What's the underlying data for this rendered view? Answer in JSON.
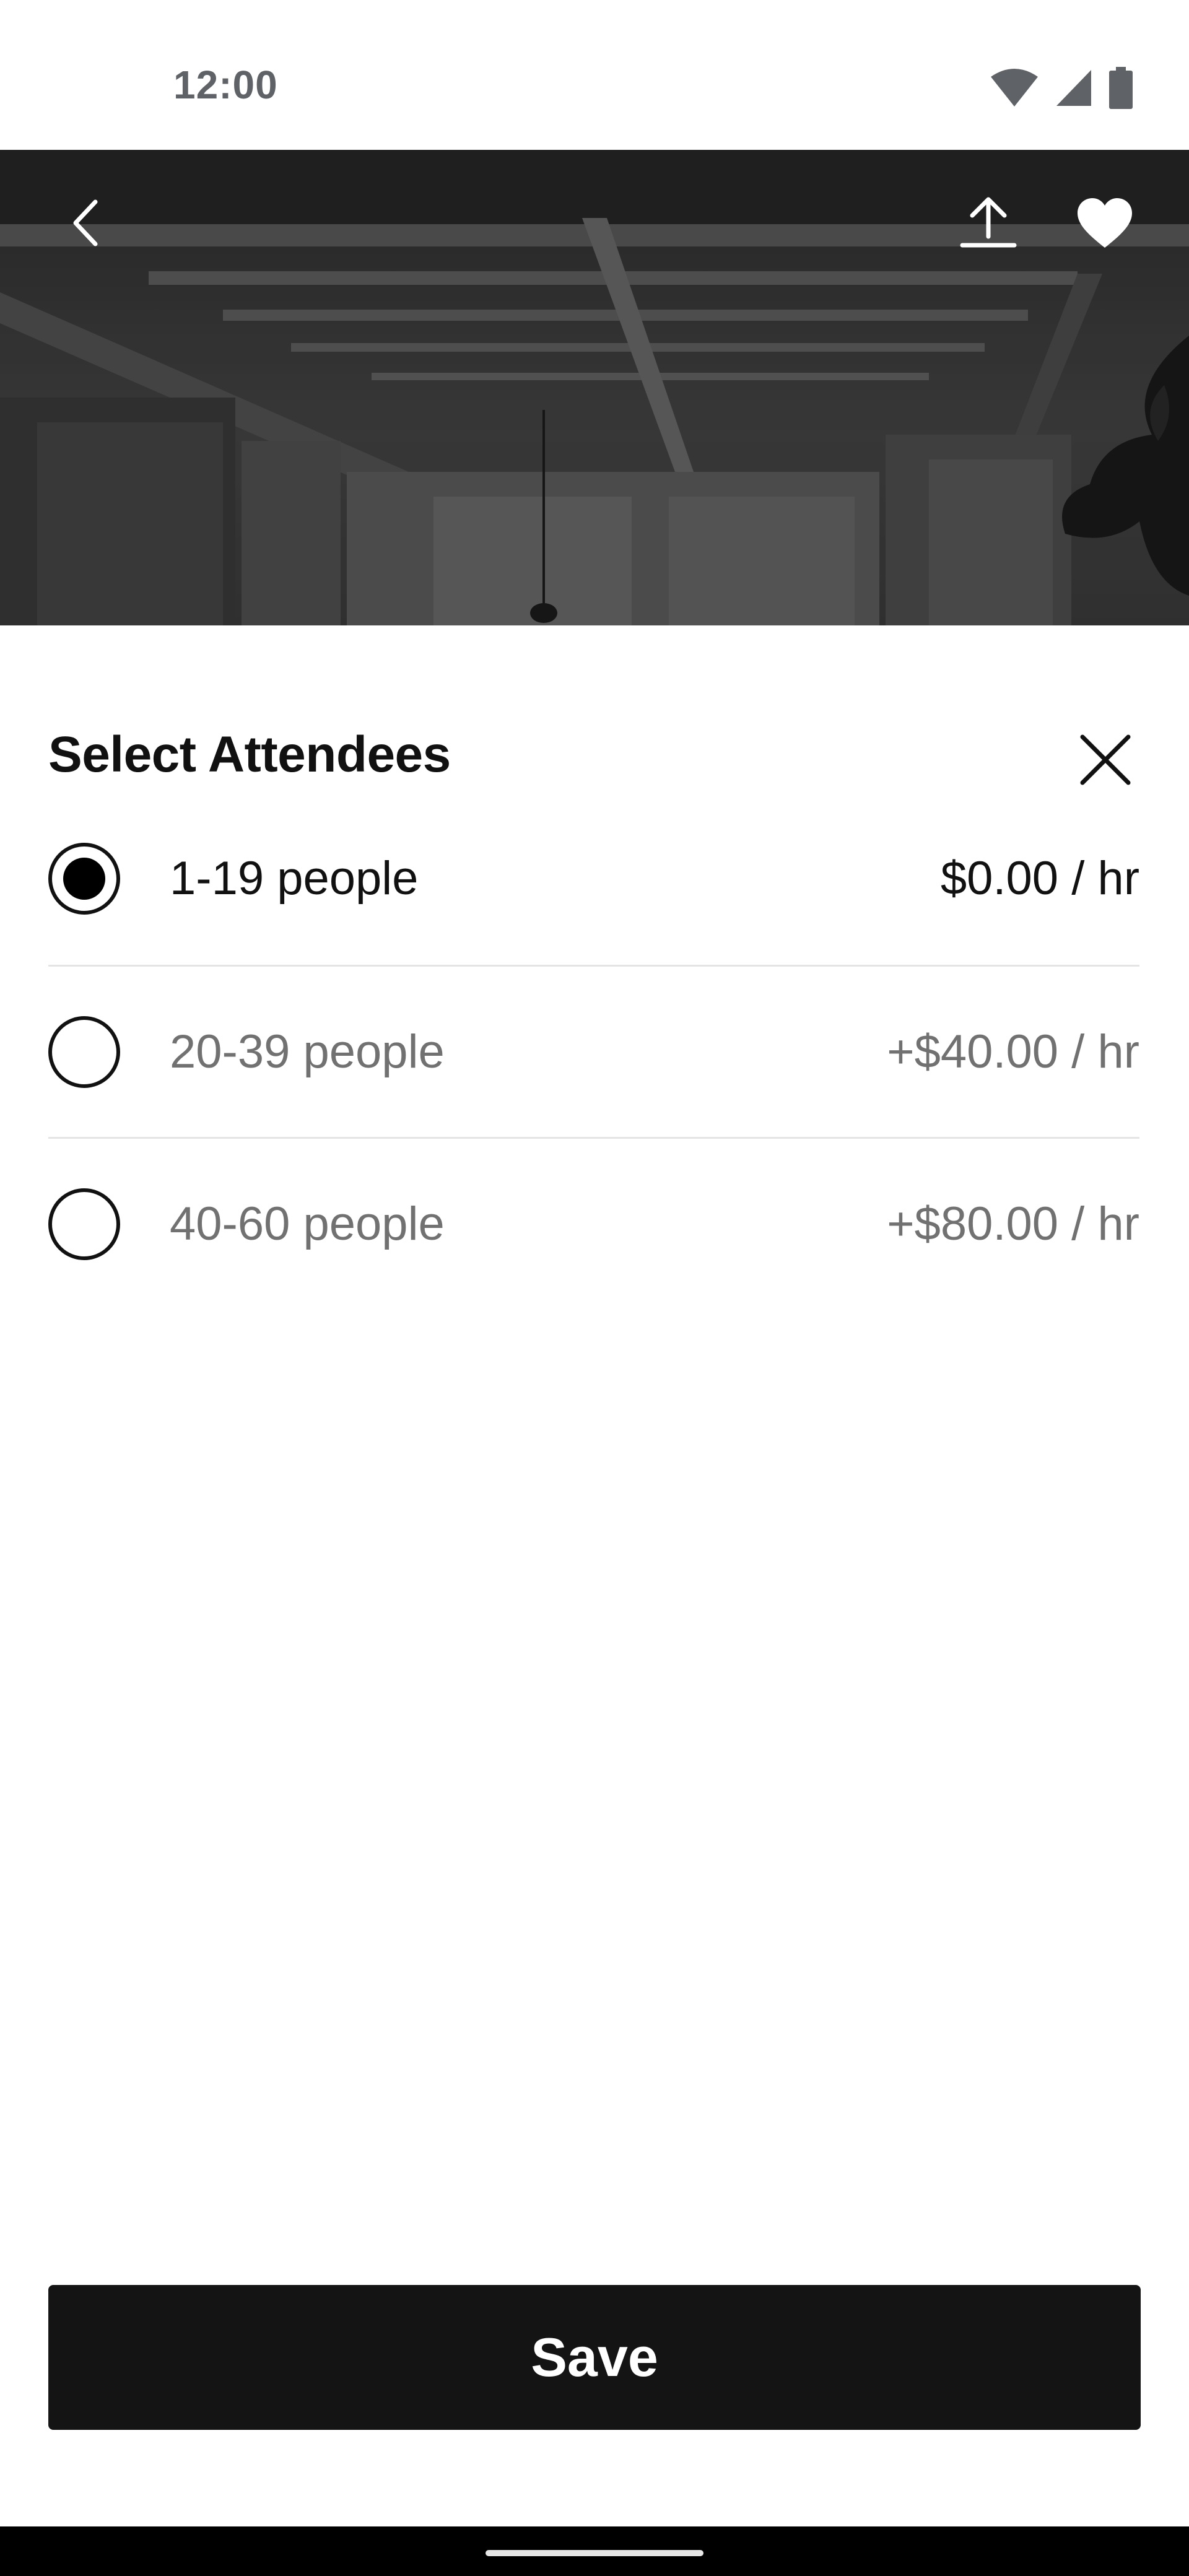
{
  "status_bar": {
    "time": "12:00",
    "icons": [
      "wifi-icon",
      "cell-signal-icon",
      "battery-icon"
    ]
  },
  "hero": {
    "icons": [
      "back-chevron-icon",
      "share-upload-icon",
      "heart-icon"
    ]
  },
  "sheet": {
    "title": "Select Attendees",
    "close_icon": "close-icon",
    "options": [
      {
        "label": "1-19 people",
        "price": "$0.00 / hr",
        "selected": true
      },
      {
        "label": "20-39 people",
        "price": "+$40.00 / hr",
        "selected": false
      },
      {
        "label": "40-60 people",
        "price": "+$80.00 / hr",
        "selected": false
      }
    ]
  },
  "save_label": "Save",
  "colors": {
    "primary_text": "#111111",
    "muted_text": "#717171",
    "button_bg": "#141414",
    "divider": "#e4e4e4",
    "status_text": "#5f6368"
  }
}
